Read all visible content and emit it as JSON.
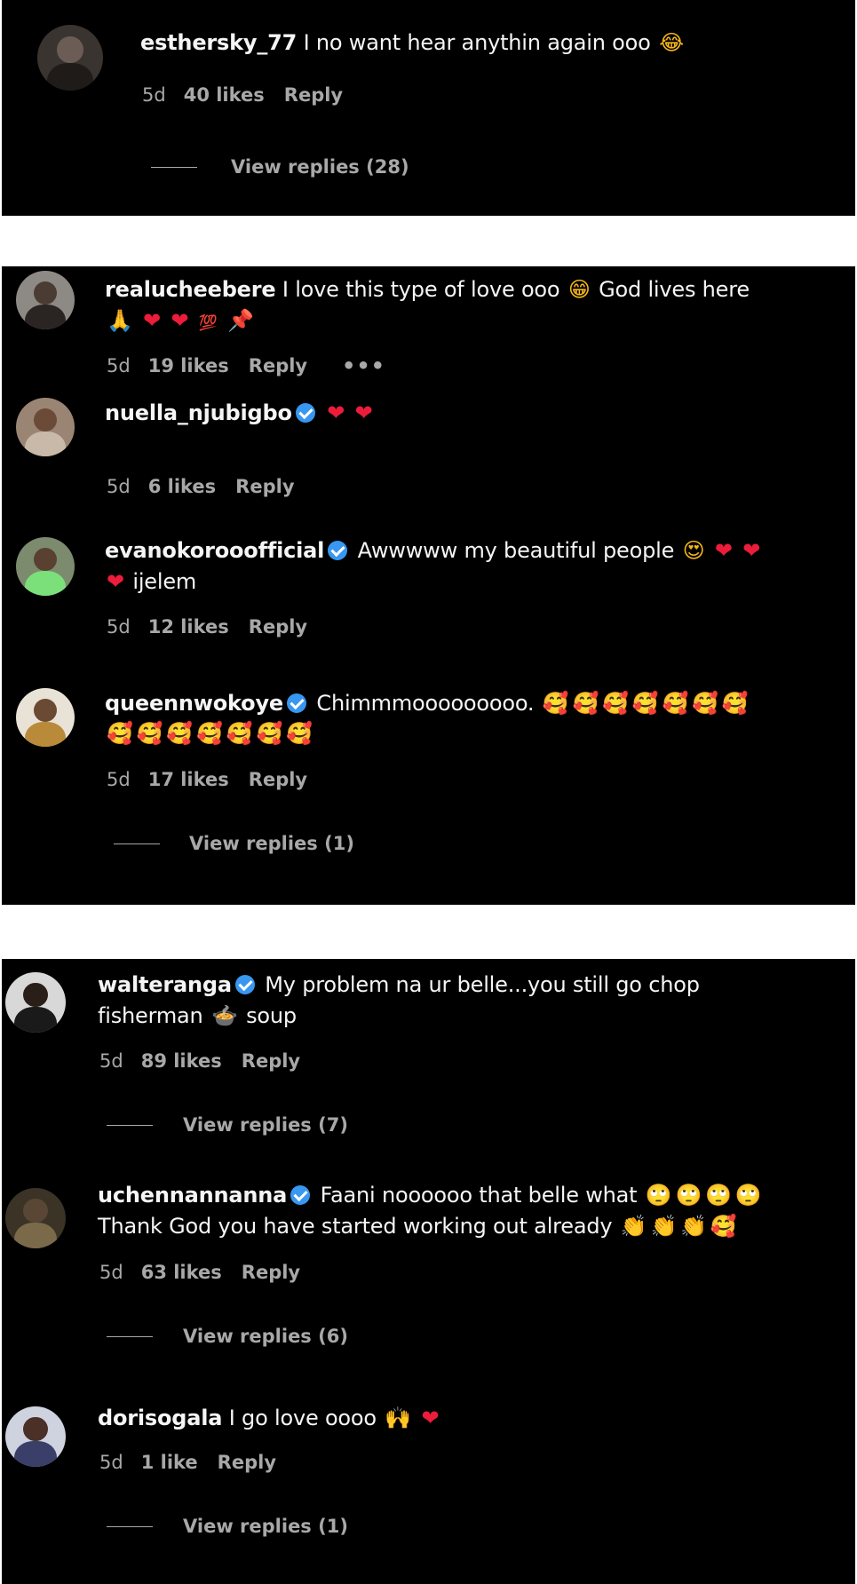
{
  "colors": {
    "background": "#000000",
    "text": "#f5f5f5",
    "muted": "#a8a8a8",
    "verified": "#3897f0",
    "heart": "#ed1c3b"
  },
  "panels": [
    {
      "comments": [
        {
          "username": "esthersky_77",
          "verified": false,
          "text_line1": "I no want hear anythin again ooo",
          "line1_emojis": [
            "😂"
          ],
          "time": "5d",
          "likes": "40 likes",
          "reply": "Reply",
          "view_replies": "View replies (28)"
        }
      ]
    },
    {
      "comments": [
        {
          "username": "realucheebere",
          "verified": false,
          "text_line1": "I love this type of love ooo",
          "line1_emojis_mid": [
            "😁"
          ],
          "text_line1_b": "God lives here",
          "line2_emojis": [
            "🙏",
            "❤",
            "❤",
            "💯",
            "📌"
          ],
          "time": "5d",
          "likes": "19 likes",
          "reply": "Reply",
          "more": "•••"
        },
        {
          "username": "nuella_njubigbo",
          "verified": true,
          "line1_emojis": [
            "❤",
            "❤"
          ],
          "time": "5d",
          "likes": "6 likes",
          "reply": "Reply"
        },
        {
          "username": "evanokorooofficial",
          "verified": true,
          "text_line1": "Awwwww my beautiful people",
          "line1_emojis": [
            "😍",
            "❤",
            "❤"
          ],
          "line2_emojis": [
            "❤"
          ],
          "text_line2": "ijelem",
          "time": "5d",
          "likes": "12 likes",
          "reply": "Reply"
        },
        {
          "username": "queennwokoye",
          "verified": true,
          "text_line1": "Chimmmooooooooo.",
          "line1_emojis": [
            "🥰",
            "🥰",
            "🥰",
            "🥰",
            "🥰",
            "🥰",
            "🥰"
          ],
          "line2_emojis": [
            "🥰",
            "🥰",
            "🥰",
            "🥰",
            "🥰",
            "🥰",
            "🥰"
          ],
          "time": "5d",
          "likes": "17 likes",
          "reply": "Reply",
          "view_replies": "View replies (1)"
        }
      ]
    },
    {
      "comments": [
        {
          "username": "walteranga",
          "verified": true,
          "text_line1": "My problem na ur belle...you still go chop",
          "text_line2": "fisherman",
          "line2_emojis": [
            "🍲"
          ],
          "text_line2_b": "soup",
          "time": "5d",
          "likes": "89 likes",
          "reply": "Reply",
          "view_replies": "View replies (7)"
        },
        {
          "username": "uchennannanna",
          "verified": true,
          "text_line1": "Faani noooooo that belle what",
          "line1_emojis": [
            "🙄",
            "🙄",
            "🙄",
            "🙄"
          ],
          "text_line2": "Thank God you have started working out already",
          "line2_emojis": [
            "👏",
            "👏",
            "👏",
            "🥰"
          ],
          "time": "5d",
          "likes": "63 likes",
          "reply": "Reply",
          "view_replies": "View replies (6)"
        },
        {
          "username": "dorisogala",
          "verified": false,
          "text_line1": "I go love oooo",
          "line1_emojis": [
            "🙌",
            "❤"
          ],
          "time": "5d",
          "likes": "1 like",
          "reply": "Reply",
          "view_replies": "View replies (1)"
        }
      ]
    }
  ]
}
